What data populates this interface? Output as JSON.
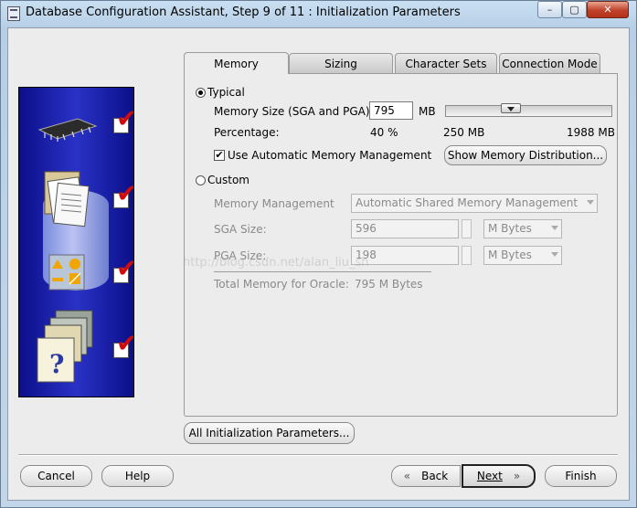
{
  "window": {
    "title": "Database Configuration Assistant, Step 9 of 11 : Initialization Parameters",
    "controls": {
      "minimize": "–",
      "maximize": "▢",
      "close": "✕"
    }
  },
  "tabs": [
    {
      "label": "Memory",
      "active": true
    },
    {
      "label": "Sizing",
      "active": false
    },
    {
      "label": "Character Sets",
      "active": false
    },
    {
      "label": "Connection Mode",
      "active": false
    }
  ],
  "memory": {
    "typical_label": "Typical",
    "typical_selected": true,
    "memory_size_label": "Memory Size (SGA and PGA):",
    "memory_size_value": "795",
    "memory_size_unit": "MB",
    "slider": {
      "min_label": "250 MB",
      "max_label": "1988 MB",
      "min": 250,
      "max": 1988,
      "value": 795
    },
    "percentage_label": "Percentage:",
    "percentage_value": "40 %",
    "auto_mm_label": "Use Automatic Memory Management",
    "auto_mm_checked": true,
    "show_distribution_button": "Show Memory Distribution...",
    "custom_label": "Custom",
    "custom_selected": false,
    "memory_management_label": "Memory Management",
    "memory_management_value": "Automatic Shared Memory Management",
    "sga_label": "SGA Size:",
    "sga_value": "596",
    "sga_unit": "M Bytes",
    "pga_label": "PGA Size:",
    "pga_value": "198",
    "pga_unit": "M Bytes",
    "total_label": "Total Memory for Oracle:",
    "total_value": "795 M Bytes"
  },
  "watermark": "http://blog.csdn.net/alan_liu_sh",
  "all_params_button": "All Initialization Parameters...",
  "footer": {
    "cancel": "Cancel",
    "help": "Help",
    "back": "Back",
    "next": "Next",
    "finish": "Finish"
  },
  "icons": [
    "chip-icon",
    "documents-icon",
    "database-cylinder-icon",
    "shapes-icon",
    "folders-icon",
    "help-document-icon",
    "checkmark-icon"
  ],
  "colors": {
    "art_background": "#1a1fb0",
    "check_mark": "#d10b0b",
    "title_bar": "#c3d6e9"
  }
}
